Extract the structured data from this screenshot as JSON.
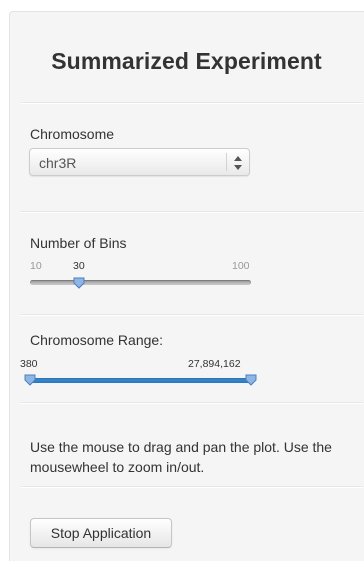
{
  "panel": {
    "title": "Summarized Experiment"
  },
  "chromosome": {
    "label": "Chromosome",
    "selected": "chr3R",
    "icon": "select-arrows-icon"
  },
  "bins": {
    "label": "Number of Bins",
    "min": "10",
    "max": "100",
    "value": "30",
    "fraction": 0.222
  },
  "range": {
    "label": "Chromosome Range:",
    "from": "380",
    "to": "27,894,162",
    "from_fraction": 0.0,
    "to_fraction": 1.0,
    "accent": "#2f80c9"
  },
  "help_text": "Use the mouse to drag and pan the plot. Use the mousewheel to zoom in/out.",
  "stop_button": {
    "label": "Stop Application"
  },
  "colors": {
    "panel_background": "#f5f5f5",
    "slider_track": "#b5b5b5",
    "range_fill": "#2f80c9",
    "handle": "#7aa6dc"
  }
}
